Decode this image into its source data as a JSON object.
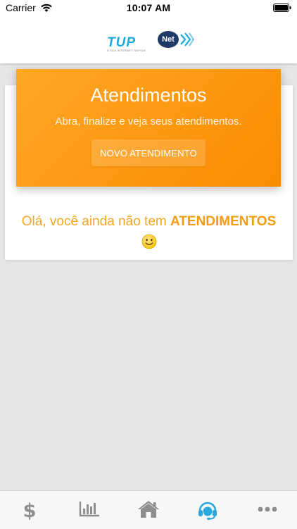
{
  "status_bar": {
    "carrier": "Carrier",
    "time": "10:07 AM"
  },
  "header": {
    "logo_text": "TUP",
    "logo_badge": "Net",
    "logo_tagline": "A SUA INTERNET RÁPIDA"
  },
  "banner": {
    "title": "Atendimentos",
    "subtitle": "Abra, finalize e veja seus atendimentos.",
    "button_label": "NOVO ATENDIMENTO"
  },
  "empty_state": {
    "prefix": "Olá, você ainda não tem ",
    "highlight": "ATENDIMENTOS",
    "emoji": "smiley-icon"
  },
  "tab_bar": {
    "items": [
      {
        "icon": "dollar-icon",
        "active": false
      },
      {
        "icon": "bar-chart-icon",
        "active": false
      },
      {
        "icon": "home-icon",
        "active": false
      },
      {
        "icon": "headset-icon",
        "active": true
      },
      {
        "icon": "more-icon",
        "active": false
      }
    ]
  },
  "colors": {
    "accent_orange": "#fb8c00",
    "text_orange": "#f5a623",
    "active_tab": "#29a8e0",
    "inactive_tab": "#8e8e8e",
    "brand_blue": "#1ba9e1"
  }
}
